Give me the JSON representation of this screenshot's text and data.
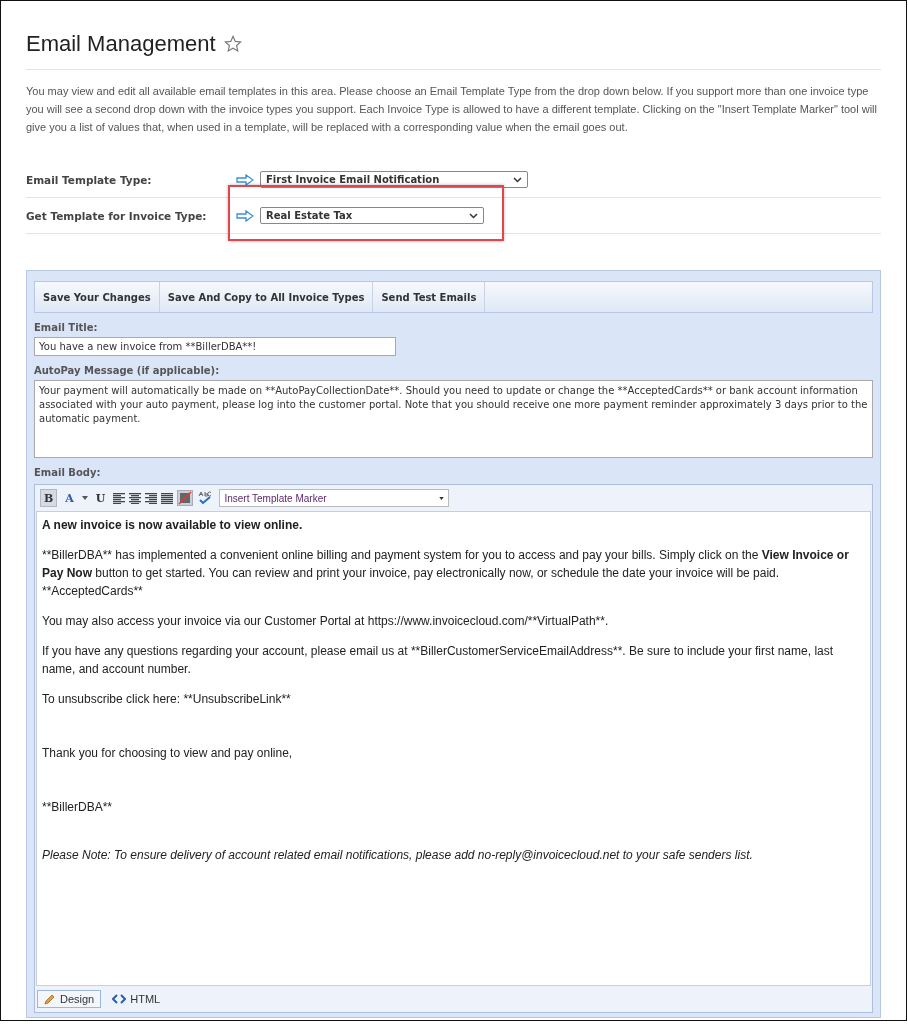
{
  "page": {
    "title": "Email Management",
    "favorite": false
  },
  "description": "You may view and edit all available email templates in this area. Please choose an Email Template Type from the drop down below. If you support more than one invoice type you will see a second drop down with the invoice types you support. Each Invoice Type is allowed to have a different template. Clicking on the \"Insert Template Marker\" tool will give you a list of values that, when used in a template, will be replaced with a corresponding value when the email goes out.",
  "settings": [
    {
      "label": "Email Template Type:",
      "value": "First Invoice Email Notification",
      "highlighted": false
    },
    {
      "label": "Get Template for Invoice Type:",
      "value": "Real Estate Tax",
      "highlighted": true
    }
  ],
  "editor": {
    "actions": [
      "Save Your Changes",
      "Save And Copy to All Invoice Types",
      "Send Test Emails"
    ],
    "email_title": {
      "label": "Email Title:",
      "value": "You have a new invoice from **BillerDBA**!"
    },
    "autopay": {
      "label": "AutoPay Message (if applicable):",
      "value": "Your payment will automatically be made on **AutoPayCollectionDate**. Should you need to update or change the **AcceptedCards** or bank account information associated with your auto payment, please log into the customer portal. Note that you should receive one more payment reminder approximately 3 days prior to the automatic payment."
    },
    "body_label": "Email Body:",
    "format_buttons": [
      {
        "label": "B",
        "selected": true
      },
      {
        "label": "A",
        "selected": false
      },
      {
        "label": "U",
        "selected": false
      }
    ],
    "marker_select": "Insert Template Marker",
    "body": [
      {
        "kind": "text",
        "runs": [
          {
            "text": "A new invoice is now available to view online.",
            "bold": true
          }
        ]
      },
      {
        "kind": "text",
        "runs": [
          {
            "text": "**BillerDBA** has implemented a convenient online billing and payment system for you to access and pay your bills. Simply click on the ",
            "bold": false
          },
          {
            "text": "View Invoice or Pay Now",
            "bold": true
          },
          {
            "text": " button to get started. You can review and print your invoice, pay electronically now, or schedule the date your invoice will be paid.  **AcceptedCards**",
            "bold": false
          }
        ]
      },
      {
        "kind": "text",
        "runs": [
          {
            "text": "You may also access your invoice via our Customer Portal at https://www.invoicecloud.com/**VirtualPath**.",
            "bold": false
          }
        ]
      },
      {
        "kind": "text",
        "runs": [
          {
            "text": "If you have any questions regarding your account, please email us at **BillerCustomerServiceEmailAddress**. Be sure to include your first name, last name, and account number.",
            "bold": false
          }
        ]
      },
      {
        "kind": "text",
        "runs": [
          {
            "text": "To unsubscribe click here: **UnsubscribeLink**",
            "bold": false
          }
        ]
      },
      {
        "kind": "spaced",
        "runs": [
          {
            "text": "Thank you for choosing to view and pay online,",
            "bold": false
          }
        ]
      },
      {
        "kind": "spaced",
        "runs": [
          {
            "text": "**BillerDBA**",
            "bold": false
          }
        ]
      },
      {
        "kind": "italic",
        "runs": [
          {
            "text": "Please Note: To ensure delivery of account related email notifications, please add no-reply@invoicecloud.net to your safe senders list.",
            "bold": false
          }
        ]
      }
    ],
    "modes": [
      {
        "label": "Design",
        "selected": true
      },
      {
        "label": "HTML",
        "selected": false
      }
    ]
  }
}
